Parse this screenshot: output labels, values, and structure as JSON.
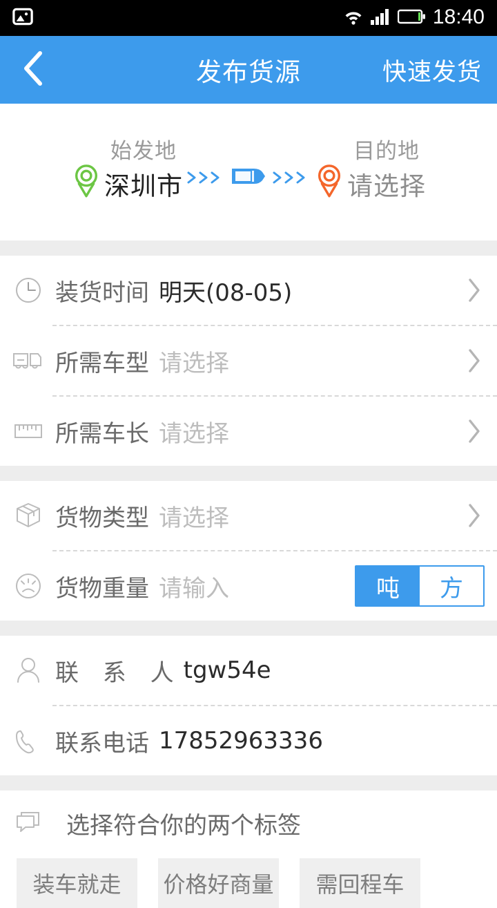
{
  "status_bar": {
    "left_icon": "photo-icon",
    "icons": [
      "wifi-icon",
      "cellular-signal-icon",
      "battery-icon"
    ],
    "time": "18:40"
  },
  "header": {
    "back_icon": "back-chevron-icon",
    "title": "发布货源",
    "action_label": "快速发货"
  },
  "route": {
    "origin": {
      "pin_icon": "location-pin-green-icon",
      "caption": "始发地",
      "value": "深圳市"
    },
    "middle_icon": "truck-top-view-icon",
    "destination": {
      "pin_icon": "location-pin-orange-icon",
      "caption": "目的地",
      "value": "请选择"
    }
  },
  "groups": [
    {
      "rows": [
        {
          "icon": "clock-icon",
          "label": "装货时间",
          "value": "明天(08-05)",
          "is_placeholder": false,
          "chevron": true
        },
        {
          "icon": "truck-side-icon",
          "label": "所需车型",
          "value": "请选择",
          "is_placeholder": true,
          "chevron": true
        },
        {
          "icon": "ruler-icon",
          "label": "所需车长",
          "value": "请选择",
          "is_placeholder": true,
          "chevron": true
        }
      ]
    },
    {
      "rows": [
        {
          "icon": "box-icon",
          "label": "货物类型",
          "value": "请选择",
          "is_placeholder": true,
          "chevron": true
        },
        {
          "icon": "gauge-icon",
          "label": "货物重量",
          "value": "请输入",
          "is_placeholder": true,
          "chevron": false
        }
      ]
    },
    {
      "rows": [
        {
          "icon": "person-icon",
          "label": "联 系 人",
          "value": "tgw54e",
          "is_placeholder": false,
          "chevron": false
        },
        {
          "icon": "phone-icon",
          "label": "联系电话",
          "value": "17852963336",
          "is_placeholder": false,
          "chevron": false
        }
      ]
    }
  ],
  "weight_unit_toggle": {
    "options": [
      "吨",
      "方"
    ],
    "selected": "吨"
  },
  "tags": {
    "icon": "speech-bubble-icon",
    "heading": "选择符合你的两个标签",
    "chips": [
      "装车就走",
      "价格好商量",
      "需回程车"
    ]
  },
  "colors": {
    "accent_blue": "#3d9bec",
    "status_bar_bg": "#000000",
    "gap_gray": "#ededed",
    "origin_pin": "#6cc644",
    "destination_pin": "#f4662b",
    "chip_bg": "#efefef"
  }
}
